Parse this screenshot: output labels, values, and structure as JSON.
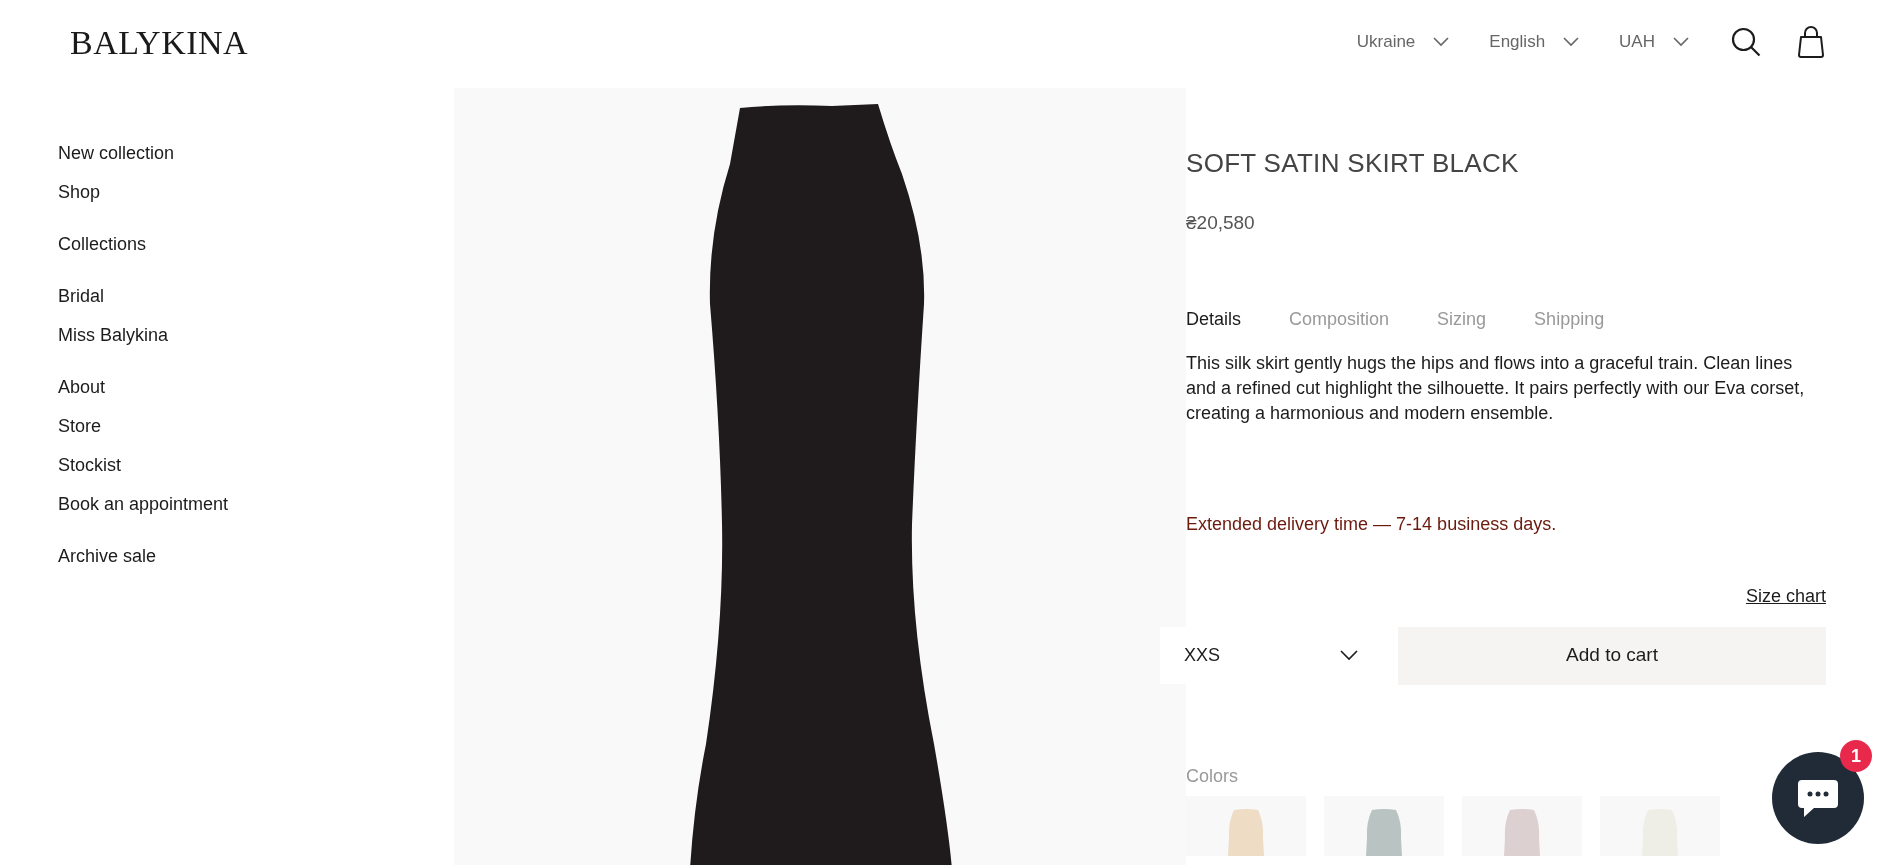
{
  "header": {
    "logo": "BALYKINA",
    "selectors": [
      {
        "label": "Ukraine"
      },
      {
        "label": "English"
      },
      {
        "label": "UAH"
      }
    ]
  },
  "nav": {
    "groups": [
      [
        "New collection",
        "Shop"
      ],
      [
        "Collections"
      ],
      [
        "Bridal",
        "Miss Balykina"
      ],
      [
        "About",
        "Store",
        "Stockist",
        "Book an appointment"
      ],
      [
        "Archive sale"
      ]
    ]
  },
  "product": {
    "title": "SOFT SATIN SKIRT BLACK",
    "price": "₴20,580",
    "tabs": [
      {
        "label": "Details",
        "selected": true
      },
      {
        "label": "Composition",
        "selected": false
      },
      {
        "label": "Sizing",
        "selected": false
      },
      {
        "label": "Shipping",
        "selected": false
      }
    ],
    "description": "This silk skirt gently hugs the hips and flows into a graceful train. Clean lines and a refined cut highlight the silhouette. It pairs perfectly with our Eva corset, creating a harmonious and modern ensemble.",
    "delivery_note": "Extended delivery time — 7-14 business days.",
    "size_chart": "Size chart",
    "size": "XXS",
    "add_to_cart": "Add to cart",
    "colors_label": "Colors",
    "colors": [
      {
        "color": "#efdcc5"
      },
      {
        "color": "#b9c3c2"
      },
      {
        "color": "#ddd0d0"
      },
      {
        "color": "#eeeee6"
      }
    ]
  },
  "chat": {
    "badge": "1"
  }
}
